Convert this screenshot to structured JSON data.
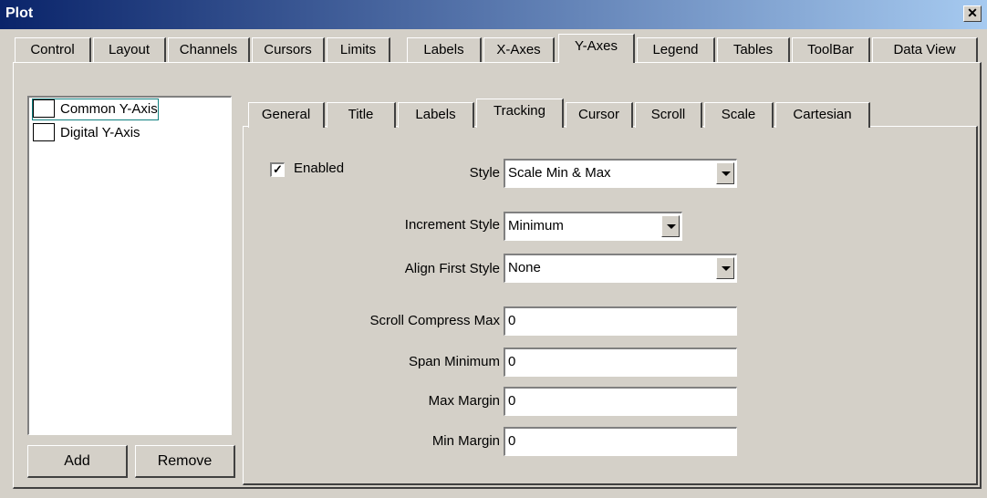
{
  "window": {
    "title": "Plot",
    "close_glyph": "✕"
  },
  "main_tabs": [
    {
      "label": "Control"
    },
    {
      "label": "Layout"
    },
    {
      "label": "Channels"
    },
    {
      "label": "Cursors"
    },
    {
      "label": "Limits"
    },
    {
      "label": "Labels"
    },
    {
      "label": "X-Axes"
    },
    {
      "label": "Y-Axes"
    },
    {
      "label": "Legend"
    },
    {
      "label": "Tables"
    },
    {
      "label": "ToolBar"
    },
    {
      "label": "Data View"
    }
  ],
  "active_main_tab": "Y-Axes",
  "axis_list": {
    "items": [
      {
        "label": "Common Y-Axis",
        "selected": true
      },
      {
        "label": "Digital Y-Axis",
        "selected": false
      }
    ]
  },
  "buttons": {
    "add": "Add",
    "remove": "Remove"
  },
  "sub_tabs": [
    {
      "label": "General"
    },
    {
      "label": "Title"
    },
    {
      "label": "Labels"
    },
    {
      "label": "Tracking"
    },
    {
      "label": "Cursor"
    },
    {
      "label": "Scroll"
    },
    {
      "label": "Scale"
    },
    {
      "label": "Cartesian"
    }
  ],
  "active_sub_tab": "Tracking",
  "tracking": {
    "enabled_label": "Enabled",
    "enabled_checked": true,
    "check_glyph": "✓",
    "style_label": "Style",
    "style_value": "Scale Min & Max",
    "increment_style_label": "Increment Style",
    "increment_style_value": "Minimum",
    "align_first_style_label": "Align First Style",
    "align_first_style_value": "None",
    "scroll_compress_max_label": "Scroll Compress Max",
    "scroll_compress_max_value": "0",
    "span_minimum_label": "Span Minimum",
    "span_minimum_value": "0",
    "max_margin_label": "Max Margin",
    "max_margin_value": "0",
    "min_margin_label": "Min Margin",
    "min_margin_value": "0"
  },
  "colors": {
    "title_bar_start": "#0a246a",
    "title_bar_end": "#a6caf0",
    "selection": "#0f7f7f",
    "face": "#d4d0c8"
  }
}
